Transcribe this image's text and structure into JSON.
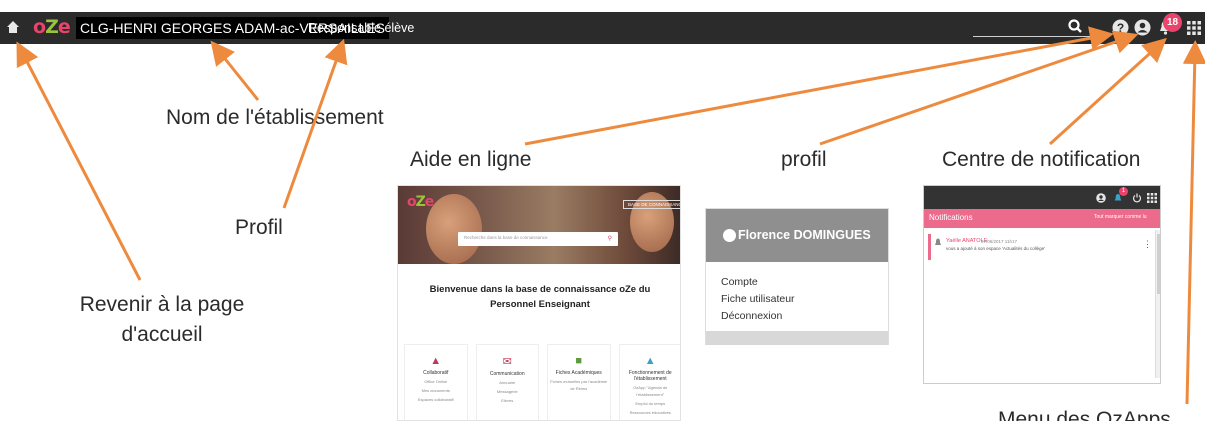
{
  "topbar": {
    "logo": {
      "o": "o",
      "z": "Z",
      "e": "e"
    },
    "school_name": "CLG-HENRI GEORGES ADAM-ac-VERSAILLES",
    "role": "Responsable élève",
    "notification_count": "18",
    "icons": [
      "home-icon",
      "search-icon",
      "help-icon",
      "profile-icon",
      "bell-icon",
      "apps-grid-icon"
    ]
  },
  "annotations": {
    "home": "Revenir à la page d'accueil",
    "school": "Nom de l'établissement",
    "profile_role": "Profil",
    "help": "Aide en ligne",
    "profile": "profil",
    "notifications": "Centre de notification",
    "apps_menu": "Menu des OzApps"
  },
  "help_panel": {
    "logo": {
      "o": "o",
      "z": "Z",
      "e": "e"
    },
    "base_button": "BASE DE CONNAISSANCE",
    "search_placeholder": "Recherche dans la base de connaissance",
    "welcome": "Bienvenue dans la base de connaissance oZe du Personnel Enseignant",
    "cards": [
      {
        "title": "Collaboratif",
        "items": [
          "Office Online",
          "Mes documents",
          "Espaces collaboratif"
        ],
        "color": "#c0395b"
      },
      {
        "title": "Communication",
        "items": [
          "Annuaire",
          "Messagerie",
          "Elèves"
        ],
        "color": "#c0395b"
      },
      {
        "title": "Fiches Académiques",
        "items": [
          "Fiches mutuelles par l'académie de Reims"
        ],
        "color": "#5a9a3a"
      },
      {
        "title": "Fonctionnement de l'établissement",
        "items": [
          "OzApp \"Agenda de l'établissement\"",
          "Emploi du temps",
          "Ressources éducatives"
        ],
        "color": "#3aa0c8"
      }
    ]
  },
  "profile_panel": {
    "name": "Florence DOMINGUES",
    "menu": [
      "Compte",
      "Fiche utilisateur",
      "Déconnexion"
    ]
  },
  "notification_panel": {
    "badge": "1",
    "title": "Notifications",
    "mark_all": "Tout marquer comme lu",
    "item": {
      "author": "Yaëlle ANATOLE",
      "date": "07/06/2017 11h17",
      "text": "vous a ajouté à son espace 'Actualités du collège'"
    }
  },
  "colors": {
    "topbar": "#2b2b2b",
    "accent_pink": "#e8446c",
    "logo_green": "#9ac53b",
    "arrow": "#ee8a3d"
  }
}
